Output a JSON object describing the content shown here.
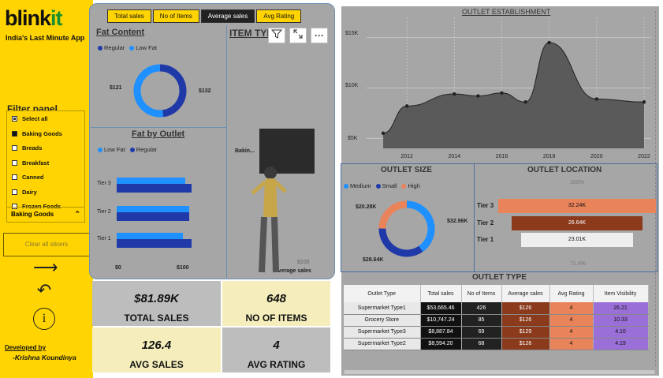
{
  "brand": {
    "name_part1": "blink",
    "name_part2": "it",
    "tagline": "India's Last Minute App"
  },
  "filter_panel": {
    "title": "Filter panel",
    "items": [
      {
        "label": "Select all",
        "state": "partial"
      },
      {
        "label": "Baking Goods",
        "state": "checked"
      },
      {
        "label": "Breads",
        "state": "unchecked"
      },
      {
        "label": "Breakfast",
        "state": "unchecked"
      },
      {
        "label": "Canned",
        "state": "unchecked"
      },
      {
        "label": "Dairy",
        "state": "unchecked"
      },
      {
        "label": "Frozen Foods",
        "state": "unchecked"
      }
    ],
    "selected_value": "Baking Goods",
    "clear_label": "Clear all slicers"
  },
  "nav_icons": [
    "arrow-right-icon",
    "undo-icon",
    "info-icon"
  ],
  "developer": {
    "label": "Developed by",
    "name": "-Krishna Koundinya"
  },
  "tabs": [
    {
      "label": "Total sales",
      "active": false
    },
    {
      "label": "No of Items",
      "active": false
    },
    {
      "label": "Average sales",
      "active": true
    },
    {
      "label": "Avg Rating",
      "active": false
    }
  ],
  "fat_content": {
    "title": "Fat Content",
    "legend": [
      {
        "name": "Regular",
        "color": "#1f3aa8"
      },
      {
        "name": "Low Fat",
        "color": "#1e90ff"
      }
    ],
    "values": {
      "Regular": "$121",
      "Low Fat": "$132"
    },
    "donut_fraction_regular": 0.48
  },
  "item_type": {
    "title": "ITEM TYPE",
    "y_label": "Bakin...",
    "x_tick": "$100",
    "x_label": "Average sales"
  },
  "fat_by_outlet": {
    "title": "Fat by Outlet",
    "legend": [
      {
        "name": "Low Fat",
        "color": "#1e90ff"
      },
      {
        "name": "Regular",
        "color": "#1f3aa8"
      }
    ],
    "categories": [
      "Tier 3",
      "Tier 2",
      "Tier 1"
    ],
    "low_fat": [
      104,
      110,
      100
    ],
    "regular": [
      113,
      110,
      113
    ],
    "x_ticks": [
      "$0",
      "$100"
    ],
    "x_max": 100
  },
  "kpis": [
    {
      "value": "$81.89K",
      "label": "TOTAL SALES",
      "bg": "#bdbdbd"
    },
    {
      "value": "648",
      "label": "NO OF ITEMS",
      "bg": "#f5eebc"
    },
    {
      "value": "126.4",
      "label": "AVG SALES",
      "bg": "#f5eebc"
    },
    {
      "value": "4",
      "label": "AVG RATING",
      "bg": "#bdbdbd"
    }
  ],
  "outlet_establishment": {
    "title": "OUTLET ESTABLISHMENT",
    "y_ticks": [
      "$15K",
      "$10K",
      "$5K"
    ],
    "x_ticks": [
      "2012",
      "2014",
      "2016",
      "2018",
      "2020",
      "2022"
    ]
  },
  "chart_data": {
    "type": "area",
    "title": "OUTLET ESTABLISHMENT",
    "x": [
      2011,
      2012,
      2014,
      2015,
      2016,
      2017,
      2018,
      2020,
      2022
    ],
    "values": [
      5.5,
      8.2,
      9.4,
      9.2,
      9.5,
      8.6,
      14.5,
      8.9,
      8.6
    ],
    "ylim": [
      4,
      17
    ],
    "xlim": [
      2010.3,
      2022.3
    ],
    "grid": true
  },
  "outlet_size": {
    "title": "OUTLET SIZE",
    "legend": [
      {
        "name": "Medium",
        "color": "#1e90ff"
      },
      {
        "name": "Small",
        "color": "#1f3aa8"
      },
      {
        "name": "High",
        "color": "#e9835a"
      }
    ],
    "labels": {
      "left": "$20.28K",
      "right": "$32.96K",
      "bottom": "$28.64K"
    },
    "slices": [
      {
        "name": "Medium",
        "value": 32.96
      },
      {
        "name": "Small",
        "value": 28.64
      },
      {
        "name": "High",
        "value": 20.28
      }
    ]
  },
  "outlet_location": {
    "title": "OUTLET LOCATION",
    "top_pct": "100%",
    "bottom_pct": "71.4%",
    "rows": [
      {
        "tier": "Tier 3",
        "value": "32.24K",
        "fraction": 1.0,
        "color": "#e9835a"
      },
      {
        "tier": "Tier 2",
        "value": "26.64K",
        "fraction": 0.826,
        "color": "#8b3a1c"
      },
      {
        "tier": "Tier 1",
        "value": "23.01K",
        "fraction": 0.714,
        "color": "#eeeeee"
      }
    ]
  },
  "outlet_type": {
    "title": "OUTLET TYPE",
    "columns": [
      "Outlet Type",
      "Total sales",
      "No of Items",
      "Average sales",
      "Avg Rating",
      "Item Visibility"
    ],
    "rows": [
      [
        "Supermarket Type1",
        "$53,665.46",
        "426",
        "$126",
        "4",
        "26.21"
      ],
      [
        "Grocery Store",
        "$10,747.24",
        "85",
        "$126",
        "4",
        "10.33"
      ],
      [
        "Supermarket Type3",
        "$8,887.84",
        "69",
        "$129",
        "4",
        "4.10"
      ],
      [
        "Supermarket Type2",
        "$8,594.20",
        "68",
        "$126",
        "4",
        "4.19"
      ]
    ]
  }
}
